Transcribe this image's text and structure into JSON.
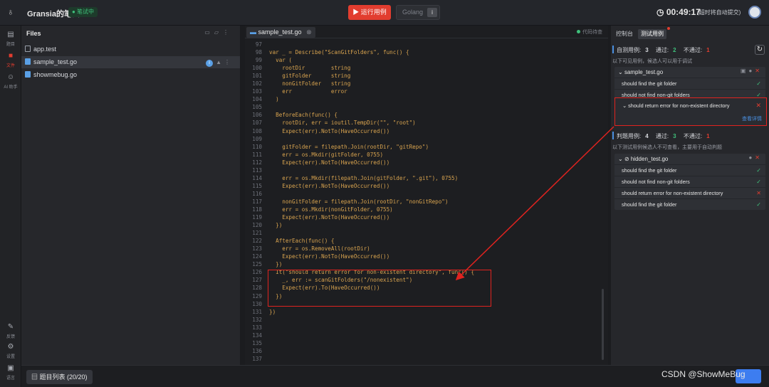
{
  "header": {
    "app_title": "Gransia的笔试",
    "status": "● 笔试中",
    "run_button": "▶ 运行用例",
    "language": "Golang",
    "language_info": "i",
    "timer": "00:49:17",
    "timer_note": "(超时将自动提交)"
  },
  "rail": {
    "items": [
      {
        "label": "题目",
        "icon": "document-icon"
      },
      {
        "label": "文件",
        "icon": "folder-icon"
      },
      {
        "label": "AI 助手",
        "icon": "robot-icon"
      }
    ],
    "bottom_items": [
      {
        "label": "反馈",
        "icon": "feedback-icon"
      },
      {
        "label": "设置",
        "icon": "gear-icon"
      },
      {
        "label": "语言",
        "icon": "language-icon"
      }
    ]
  },
  "files": {
    "header": "Files",
    "items": [
      {
        "name": "app.test",
        "type": "doc"
      },
      {
        "name": "sample_test.go",
        "type": "go",
        "active": true
      },
      {
        "name": "showmebug.go",
        "type": "go"
      }
    ]
  },
  "editor": {
    "tab": "sample_test.go",
    "tab_close": "⊗",
    "sync_status": "代码待查",
    "lines": [
      {
        "n": "97",
        "t": ""
      },
      {
        "n": "98",
        "t": "var _ = Describe(\"ScanGitFolders\", func() {"
      },
      {
        "n": "99",
        "t": "  var ("
      },
      {
        "n": "100",
        "t": "    rootDir        string"
      },
      {
        "n": "101",
        "t": "    gitFolder      string"
      },
      {
        "n": "102",
        "t": "    nonGitFolder   string"
      },
      {
        "n": "103",
        "t": "    err            error"
      },
      {
        "n": "104",
        "t": "  )"
      },
      {
        "n": "105",
        "t": ""
      },
      {
        "n": "106",
        "t": "  BeforeEach(func() {"
      },
      {
        "n": "107",
        "t": "    rootDir, err = ioutil.TempDir(\"\", \"root\")"
      },
      {
        "n": "108",
        "t": "    Expect(err).NotTo(HaveOccurred())"
      },
      {
        "n": "109",
        "t": ""
      },
      {
        "n": "110",
        "t": "    gitFolder = filepath.Join(rootDir, \"gitRepo\")"
      },
      {
        "n": "111",
        "t": "    err = os.Mkdir(gitFolder, 0755)"
      },
      {
        "n": "112",
        "t": "    Expect(err).NotTo(HaveOccurred())"
      },
      {
        "n": "113",
        "t": ""
      },
      {
        "n": "114",
        "t": "    err = os.Mkdir(filepath.Join(gitFolder, \".git\"), 0755)"
      },
      {
        "n": "115",
        "t": "    Expect(err).NotTo(HaveOccurred())"
      },
      {
        "n": "116",
        "t": ""
      },
      {
        "n": "117",
        "t": "    nonGitFolder = filepath.Join(rootDir, \"nonGitRepo\")"
      },
      {
        "n": "118",
        "t": "    err = os.Mkdir(nonGitFolder, 0755)"
      },
      {
        "n": "119",
        "t": "    Expect(err).NotTo(HaveOccurred())"
      },
      {
        "n": "120",
        "t": "  })"
      },
      {
        "n": "121",
        "t": ""
      },
      {
        "n": "122",
        "t": "  AfterEach(func() {"
      },
      {
        "n": "123",
        "t": "    err = os.RemoveAll(rootDir)"
      },
      {
        "n": "124",
        "t": "    Expect(err).NotTo(HaveOccurred())"
      },
      {
        "n": "125",
        "t": "  })"
      },
      {
        "n": "126",
        "t": "  It(\"should return error for non-existent directory\", func() {"
      },
      {
        "n": "127",
        "t": "    _, err := scanGitFolders(\"/nonexistent\")"
      },
      {
        "n": "128",
        "t": "    Expect(err).To(HaveOccurred())"
      },
      {
        "n": "129",
        "t": "  })"
      },
      {
        "n": "130",
        "t": ""
      },
      {
        "n": "131",
        "t": "})"
      },
      {
        "n": "132",
        "t": ""
      },
      {
        "n": "133",
        "t": ""
      },
      {
        "n": "134",
        "t": ""
      },
      {
        "n": "135",
        "t": ""
      },
      {
        "n": "136",
        "t": ""
      },
      {
        "n": "137",
        "t": ""
      }
    ]
  },
  "panel": {
    "tabs": [
      "控制台",
      "测试用例"
    ],
    "self_tests": {
      "label": "自测用例:",
      "count": "3",
      "passed_label": "通过:",
      "passed": "2",
      "failed_label": "不通过:",
      "failed": "1",
      "hint": "以下可见用例，候选人可以用于调试"
    },
    "sample_suite": {
      "title": "sample_test.go",
      "cases": [
        {
          "name": "should find the git folder",
          "status": "pass"
        },
        {
          "name": "should not find non-git folders",
          "status": "pass"
        }
      ],
      "expanded_case": "should return error for non-existent directory",
      "detail_link": "查看详情"
    },
    "judge_tests": {
      "label": "判题用例:",
      "count": "4",
      "passed_label": "通过:",
      "passed": "3",
      "failed_label": "不通过:",
      "failed": "1",
      "hint": "以下测试用例候选人不可查看，主要用于自动判题"
    },
    "hidden_suite": {
      "title": "hidden_test.go",
      "cases": [
        {
          "name": "should find the git folder",
          "status": "pass"
        },
        {
          "name": "should not find non-git folders",
          "status": "pass"
        },
        {
          "name": "should return error for non-existent directory",
          "status": "fail"
        },
        {
          "name": "should find the git folder",
          "status": "pass"
        }
      ]
    }
  },
  "footer": {
    "question_list": "题目列表 (20/20)",
    "watermark": "CSDN @ShowMeBug"
  },
  "colors": {
    "accent_red": "#e23d2f",
    "pass_green": "#3fc07b",
    "link_blue": "#4a90e2",
    "annotation_red": "#e0231f"
  }
}
